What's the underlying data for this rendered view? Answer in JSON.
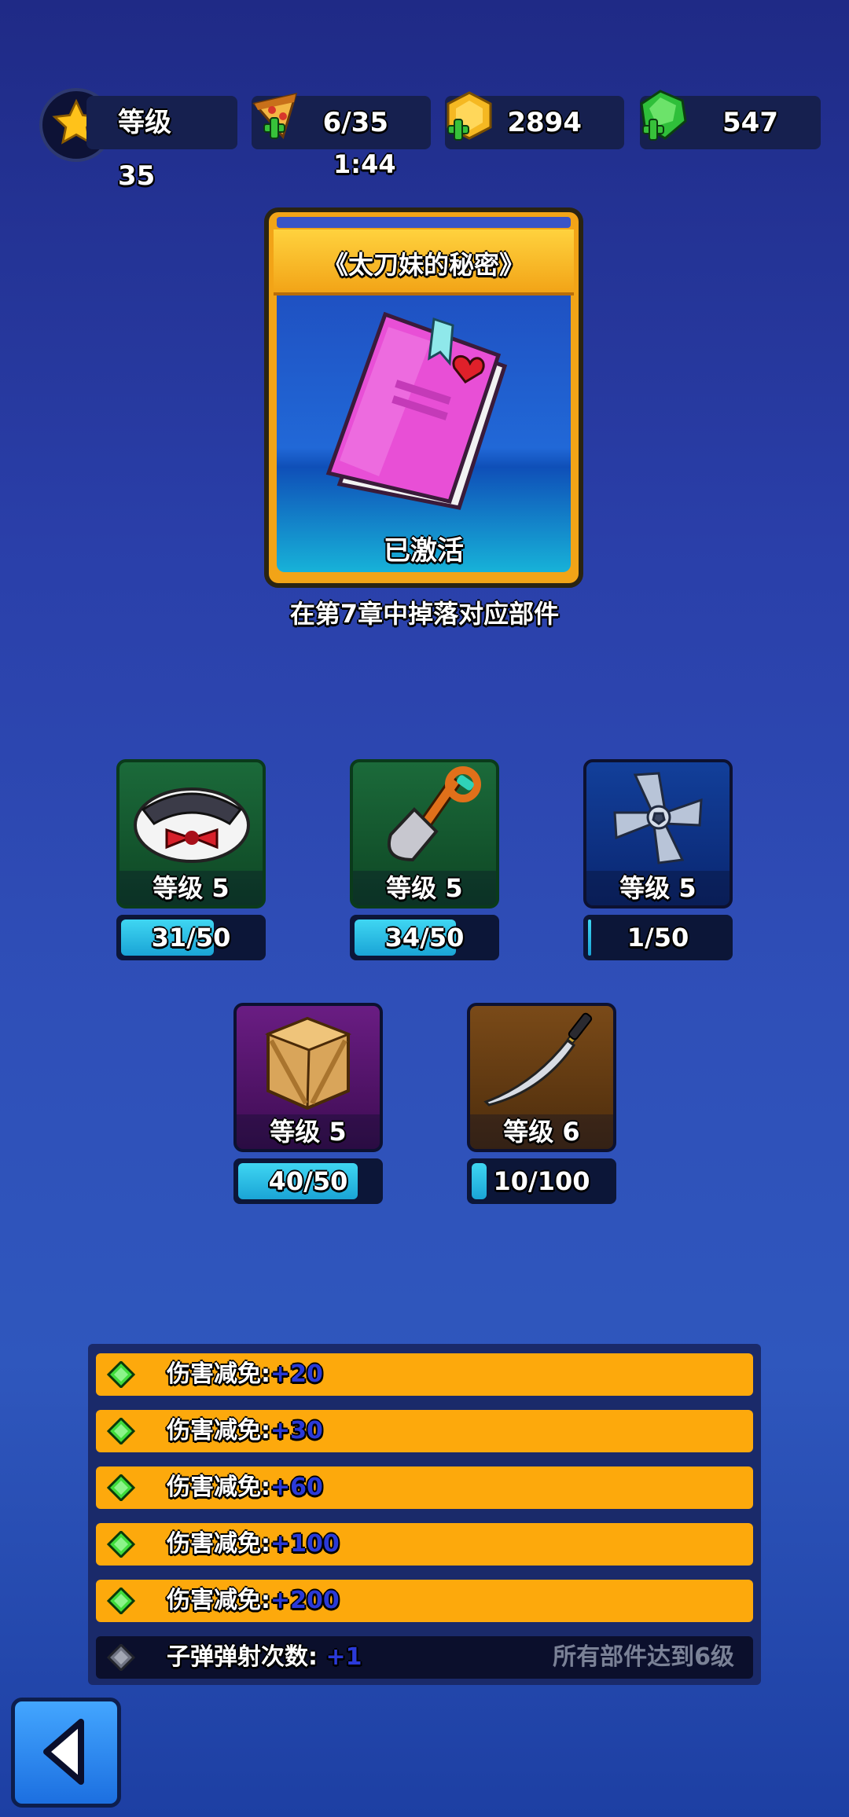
{
  "topbar": {
    "level_label": "等级 35",
    "energy": "6/35",
    "energy_timer": "1:44",
    "gold": "2894",
    "gems": "547"
  },
  "featured": {
    "title": "《太刀妹的秘密》",
    "status": "已激活",
    "hint": "在第7章中掉落对应部件"
  },
  "parts": [
    {
      "name": "水手服",
      "level": "等级 5",
      "progress": "31/50",
      "fill": 0.62,
      "color": "green",
      "icon": "sailor-uniform-icon"
    },
    {
      "name": "铲子",
      "level": "等级 5",
      "progress": "34/50",
      "fill": 0.68,
      "color": "green",
      "icon": "shovel-icon"
    },
    {
      "name": "风扇",
      "level": "等级 5",
      "progress": "1/50",
      "fill": 0.02,
      "color": "blue",
      "icon": "fan-blade-icon"
    },
    {
      "name": "木箱",
      "level": "等级 5",
      "progress": "40/50",
      "fill": 0.8,
      "color": "purple",
      "icon": "wooden-crate-icon"
    },
    {
      "name": "太刀",
      "level": "等级 6",
      "progress": "10/100",
      "fill": 0.1,
      "color": "brown",
      "icon": "katana-icon"
    }
  ],
  "bonuses": [
    {
      "label": "伤害减免:",
      "value": "+20",
      "active": true
    },
    {
      "label": "伤害减免:",
      "value": "+30",
      "active": true
    },
    {
      "label": "伤害减免:",
      "value": "+60",
      "active": true
    },
    {
      "label": "伤害减免:",
      "value": "+100",
      "active": true
    },
    {
      "label": "伤害减免:",
      "value": "+200",
      "active": true
    },
    {
      "label": "子弹弹射次数:",
      "value": "+1",
      "active": false,
      "requirement": "所有部件达到6级"
    }
  ],
  "colors": {
    "accent": "#fda90c",
    "value_blue": "#2b3ad8",
    "bar_fill": "#3fd6f2"
  }
}
